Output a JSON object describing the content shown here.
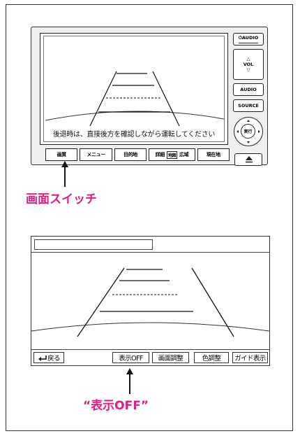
{
  "head_unit": {
    "screen_message": "後退時は、直接後方を確認しながら運転してください",
    "softkeys": [
      "画質",
      "メニュー",
      "目的地",
      "詳細",
      "地図",
      "広域",
      "現在地"
    ],
    "right_buttons": {
      "power_audio": "⏻AUDIO",
      "vol_up": "△",
      "vol": "VOL",
      "vol_down": "▽",
      "audio": "AUDIO",
      "source": "SOURCE",
      "enter": "実行"
    },
    "callout": "画面スイッチ"
  },
  "camera_screen": {
    "buttons": {
      "back": "戻る",
      "display_off": "表示OFF",
      "screen_adjust": "画面調整",
      "color_adjust": "色調整",
      "guide_display": "ガイド表示"
    },
    "callout": "“表示OFF”"
  },
  "colors": {
    "callout": "#e01e82",
    "line": "#222222"
  }
}
